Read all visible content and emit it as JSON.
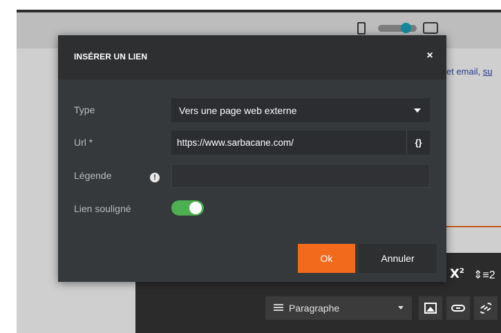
{
  "background": {
    "editor_text": "et email, ",
    "editor_link_text": "su",
    "toolbar": {
      "superscript_label": "X",
      "superscript_exponent": "2",
      "line_height_label": "⇕≡2",
      "paragraph_label": "Paragraphe"
    }
  },
  "modal": {
    "title": "INSÉRER UN LIEN",
    "close_symbol": "×",
    "fields": {
      "type": {
        "label": "Type",
        "value": "Vers une page web externe"
      },
      "url": {
        "label": "Url *",
        "value": "https://www.sarbacane.com/",
        "vars_button": "{}"
      },
      "caption": {
        "label": "Légende",
        "value": "",
        "info_symbol": "!"
      },
      "underline": {
        "label": "Lien souligné",
        "checked": true
      }
    },
    "buttons": {
      "ok": "Ok",
      "cancel": "Annuler"
    }
  },
  "colors": {
    "accent": "#f26a1b",
    "toggle_on": "#4caf50",
    "modal_bg": "#36393c",
    "modal_header": "#2d2f31",
    "device_toggle": "#13899c"
  },
  "icons": {
    "close": "close-icon",
    "select_caret": "chevron-down-icon",
    "info": "info-icon",
    "image": "image-icon",
    "link": "link-icon",
    "unlink": "unlink-icon"
  }
}
